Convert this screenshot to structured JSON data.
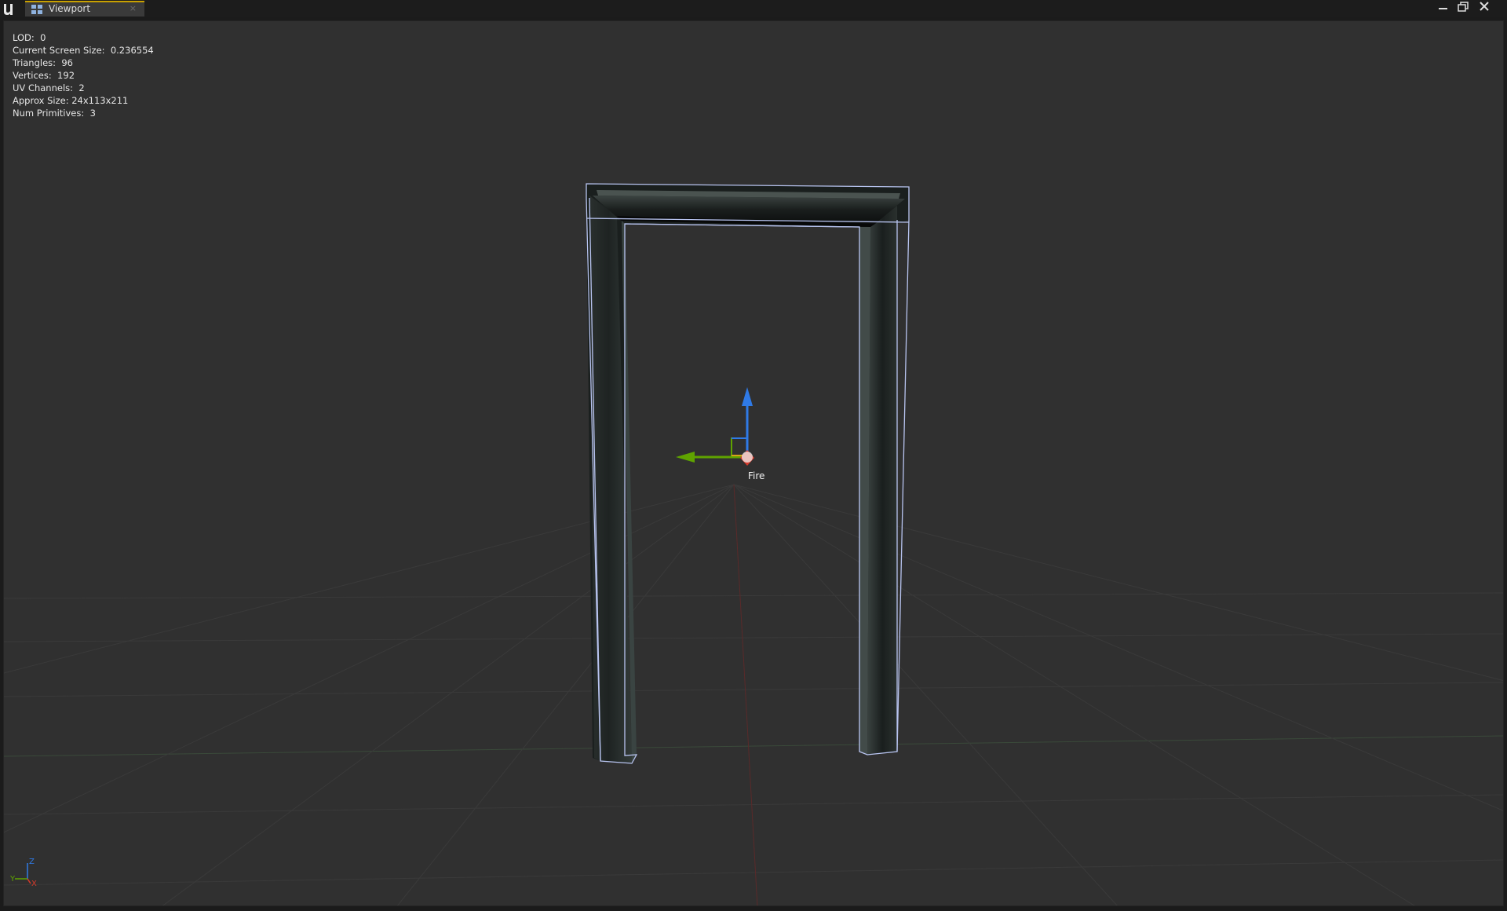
{
  "window": {
    "tab_label": "Viewport",
    "tab_close": "×"
  },
  "stats": [
    "LOD:  0",
    "Current Screen Size:  0.236554",
    "Triangles:  96",
    "Vertices:  192",
    "UV Channels:  2",
    "Approx Size: 24x113x211",
    "Num Primitives:  3"
  ],
  "gizmo": {
    "pivot_label": "Fire"
  },
  "axis_indicator": {
    "z": "Z",
    "y": "Y",
    "x": "X"
  },
  "colors": {
    "axis_x": "#d63a2b",
    "axis_y": "#5fa300",
    "axis_z": "#2f7ae6",
    "selection_outline": "#b8c4f0",
    "viewport_bg": "#303030",
    "tab_accent": "#c8a000"
  }
}
